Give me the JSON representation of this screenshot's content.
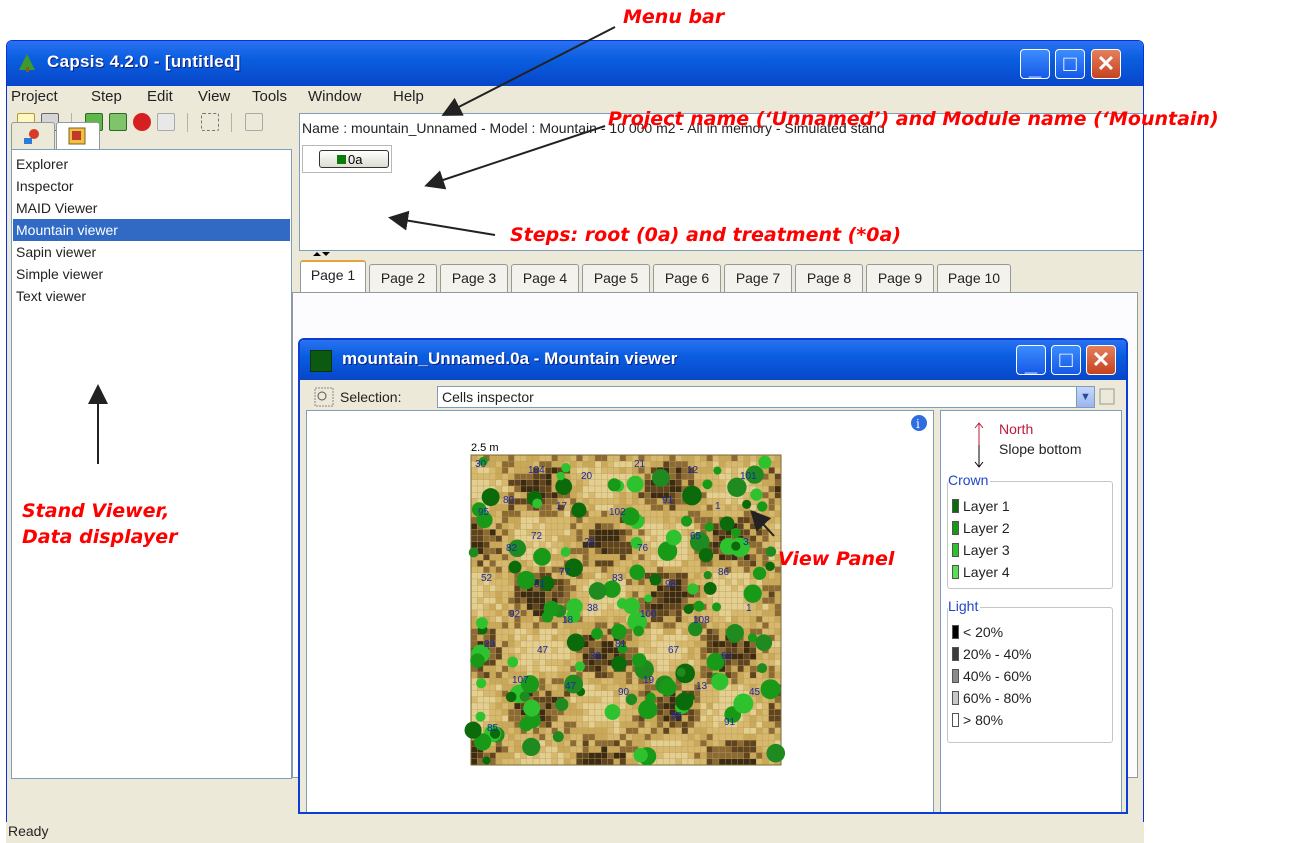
{
  "window": {
    "title": "Capsis 4.2.0 - [untitled]"
  },
  "menu": [
    "Project",
    "Step",
    "Edit",
    "View",
    "Tools",
    "Window",
    "Help"
  ],
  "viewers": {
    "items": [
      "Explorer",
      "Inspector",
      "MAID Viewer",
      "Mountain viewer",
      "Sapin viewer",
      "Simple viewer",
      "Text viewer"
    ],
    "selected": "Mountain viewer"
  },
  "project": {
    "info": "Name : mountain_Unnamed - Model : Mountain - 10 000 m2 - All in memory - Simulated stand",
    "step_label": "0a"
  },
  "pages": [
    "Page 1",
    "Page 2",
    "Page 3",
    "Page 4",
    "Page 5",
    "Page 6",
    "Page 7",
    "Page 8",
    "Page 9",
    "Page 10"
  ],
  "viewer_window": {
    "title": "mountain_Unnamed.0a - Mountain viewer",
    "selection_label": "Selection:",
    "selection_value": "Cells inspector"
  },
  "stand_map": {
    "scale_label": "2.5 m",
    "tree_ids": [
      "30",
      "104",
      "20",
      "21",
      "12",
      "101",
      "80",
      "17",
      "102",
      "91",
      "1",
      "95",
      "72",
      "28",
      "76",
      "65",
      "3",
      "82",
      "77",
      "83",
      "98",
      "86",
      "52",
      "31",
      "38",
      "100",
      "108",
      "1",
      "92",
      "18",
      "81",
      "67",
      "62",
      "23",
      "47",
      "39",
      "19",
      "13",
      "45",
      "107",
      "47",
      "90",
      "96",
      "91",
      "85"
    ]
  },
  "legend": {
    "north": "North",
    "slope": "Slope bottom",
    "crown_title": "Crown",
    "crown_layers": [
      "Layer 1",
      "Layer 2",
      "Layer 3",
      "Layer 4"
    ],
    "light_title": "Light",
    "light_classes": [
      "< 20%",
      "20% - 40%",
      "40% - 60%",
      "60% - 80%",
      "> 80%"
    ]
  },
  "status": "Ready",
  "annotations": {
    "menu_bar": "Menu bar",
    "project_name": "Project name (‘Unnamed’) and Module name (‘Mountain)",
    "steps": "Steps: root (0a) and treatment (*0a)",
    "stand_viewer": "Stand  Viewer,",
    "data_displayer": "Data displayer",
    "view_panel": "View Panel"
  },
  "colors": {
    "title_blue": "#0a5ee0",
    "selection_blue": "#316ac5",
    "annotation_red": "#ff0000",
    "crown_layers": [
      "#0b6b0b",
      "#189a18",
      "#2fc22f",
      "#55e055"
    ],
    "light_classes": [
      "#000000",
      "#3c3c3c",
      "#8a8a8a",
      "#c8c8c8",
      "#ffffff"
    ]
  },
  "icons": [
    "capsis-app-icon",
    "new-project-icon",
    "open-project-icon",
    "evolution-icon",
    "intervention-icon",
    "stop-icon",
    "inspect-icon",
    "tools-icon",
    "help-icon",
    "info-icon",
    "north-arrow-icon"
  ]
}
